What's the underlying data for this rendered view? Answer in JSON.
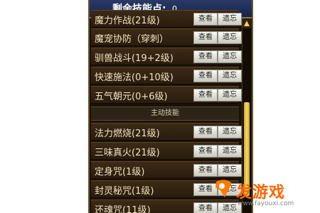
{
  "header": {
    "title": "剩余技能点:",
    "points": "0"
  },
  "skills_top": [
    {
      "name": "魔力作战(21级)"
    },
    {
      "name": "魔宠协防（穿刺）"
    },
    {
      "name": "驯兽战斗(19+2级)"
    },
    {
      "name": "快速施法(0+10级)"
    },
    {
      "name": "五气朝元(0+6级)"
    }
  ],
  "section_label": "主动技能",
  "skills_bottom": [
    {
      "name": "法力燃烧(21级)"
    },
    {
      "name": "三味真火(21级)"
    },
    {
      "name": "定身咒(1级)"
    },
    {
      "name": "封灵秘咒(1级)"
    },
    {
      "name": "还魂咒(11级)"
    }
  ],
  "buttons": {
    "view": "查看",
    "forget": "遗忘"
  },
  "watermark": {
    "text": "发游戏",
    "url": "www.fayouxi.com",
    "color": "#ff6400"
  },
  "icons": {
    "scroll_up": "triangle-up-icon"
  }
}
